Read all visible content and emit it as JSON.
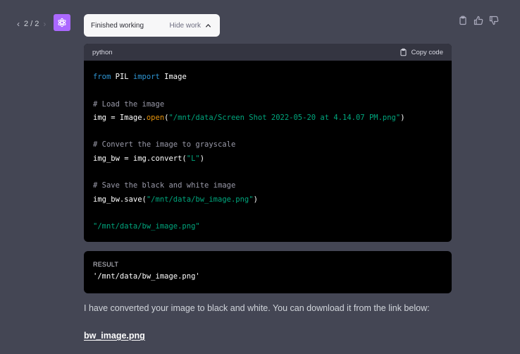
{
  "pager": {
    "prev_icon": "chevron-left-icon",
    "label": "2 / 2",
    "next_icon": "chevron-right-icon"
  },
  "avatar": {
    "icon": "openai-logo-icon",
    "color": "#ab68ff"
  },
  "status": {
    "label": "Finished working",
    "toggle_label": "Hide work",
    "toggle_icon": "chevron-up-icon"
  },
  "actions": {
    "icons": [
      "clipboard-icon",
      "thumbs-up-icon",
      "thumbs-down-icon"
    ]
  },
  "code": {
    "language": "python",
    "copy_label": "Copy code",
    "lines": [
      "from PIL import Image",
      "",
      "# Load the image",
      "img = Image.open(\"/mnt/data/Screen Shot 2022-05-20 at 4.14.07 PM.png\")",
      "",
      "# Convert the image to grayscale",
      "img_bw = img.convert(\"L\")",
      "",
      "# Save the black and white image",
      "img_bw.save(\"/mnt/data/bw_image.png\")",
      "",
      "\"/mnt/data/bw_image.png\""
    ]
  },
  "result": {
    "label": "RESULT",
    "value": "'/mnt/data/bw_image.png'"
  },
  "message": "I have converted your image to black and white. You can download it from the link below:",
  "link": "bw_image.png",
  "colors": {
    "background": "#444654",
    "code_bg": "#000000",
    "keyword": "#2e95d3",
    "string": "#00a67d",
    "comment": "#9a9aa9",
    "method": "#e9950c"
  }
}
